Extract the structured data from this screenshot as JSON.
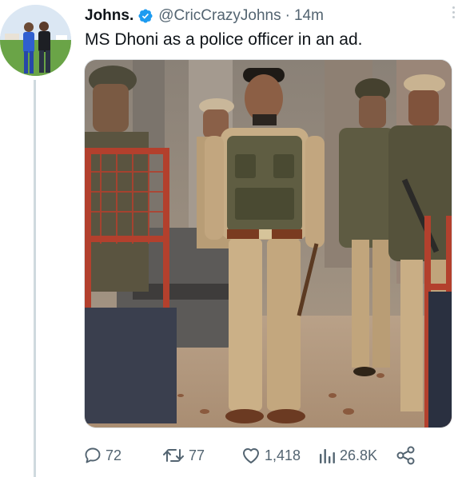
{
  "tweet": {
    "display_name": "Johns.",
    "handle": "@CricCrazyJohns",
    "separator": "·",
    "time": "14m",
    "text": "MS Dhoni as a police officer in an ad."
  },
  "actions": {
    "replies": "72",
    "retweets": "77",
    "likes": "1,418",
    "views": "26.8K"
  },
  "colors": {
    "text": "#0f1419",
    "secondary": "#536471",
    "verified": "#1d9bf0",
    "thread_line": "#cfd9de"
  },
  "icons": {
    "verified": "verified-badge-icon",
    "more": "more-vertical-icon",
    "reply": "reply-icon",
    "retweet": "retweet-icon",
    "like": "heart-icon",
    "views": "views-icon",
    "share": "share-icon"
  }
}
